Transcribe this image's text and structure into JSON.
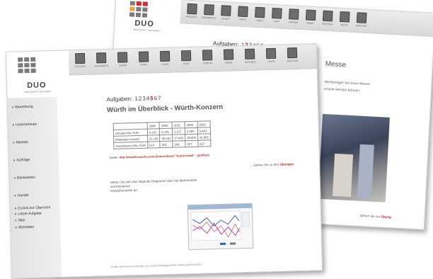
{
  "brand": {
    "name": "DUO",
    "tagline": "WIRTSCHAFT UND ARBEIT",
    "colors": {
      "red": "#d42a2a",
      "orange": "#f0a13a",
      "gray": "#7a7a7a",
      "link": "#c21a1a"
    }
  },
  "toolbar": {
    "items": [
      {
        "label": "PROJEKT",
        "icon": "project-icon"
      },
      {
        "label": "GRAMMATIK",
        "icon": "grammar-icon"
      },
      {
        "label": "LESEN",
        "icon": "reading-icon"
      },
      {
        "label": "TIPPS",
        "icon": "tips-icon"
      },
      {
        "label": "LINKS",
        "icon": "links-icon"
      },
      {
        "label": "CHAT",
        "icon": "chat-icon"
      },
      {
        "label": "FORUM",
        "icon": "forum-icon"
      },
      {
        "label": "EMAIL",
        "icon": "email-icon"
      },
      {
        "label": "NOTIZEN",
        "icon": "notes-icon"
      },
      {
        "label": "HILFE",
        "icon": "help-icon"
      },
      {
        "label": "ANALYSE",
        "icon": "analysis-icon"
      }
    ]
  },
  "back_window": {
    "aufgaben_label": "Aufgaben:",
    "tasks": [
      "1",
      "2",
      "3",
      "4",
      "5",
      "6"
    ],
    "current_task": "2",
    "title": "Messe",
    "text_line1": "Werbeträger bei einer Messe",
    "text_line2": "ersicht werden können.",
    "goto_prefix": "Gehen Sie zur",
    "goto_link": "Übung"
  },
  "front_window": {
    "aufgaben_label": "Aufgaben:",
    "tasks": [
      "1",
      "2",
      "3",
      "4",
      "5",
      "6",
      "7"
    ],
    "current_task": "5",
    "title": "Würth im Überblick - Würth-Konzern",
    "sidebar": [
      "Bewerbung",
      "Unternehmen",
      "Messen",
      "Aufträge",
      "Bankwesen",
      "Handel",
      "Zurück zur Übersicht",
      "Letzte Aufgabe",
      "Skip",
      "Abmelden"
    ],
    "table": {
      "header": [
        "",
        "1999",
        "2000",
        "2001",
        "2002",
        "2003"
      ],
      "rows": [
        [
          "Umsatz Mio. EUR",
          "4.110",
          "5.135",
          "5.217",
          "5.360",
          "5.463"
        ],
        [
          "Mitarbeiter Anzahl",
          "31.165",
          "36.161",
          "37.402",
          "39.800",
          "41.962"
        ],
        [
          "Investitionen Mio. EUR",
          "216",
          "251",
          "249",
          "227",
          "217"
        ]
      ]
    },
    "quelle_prefix": "Quelle:",
    "quelle_link": "http://www05.wuerth.com/ (Unternehmen \"Konzernzahl\" - geöffnet)",
    "goto_prefix": "Gehen Sie zu den",
    "goto_link": "Übungen.",
    "intro_line1": "Sehen Sie sich das folgende Diagramm über die Marktanteile verschiedener",
    "intro_line2": "Handyhersteller an.",
    "footer": "Grafik: http://www.nw.ie/politik_von_world.pdf/tabgame/ENE-1998/8.pdf/Kurdl.2003"
  }
}
